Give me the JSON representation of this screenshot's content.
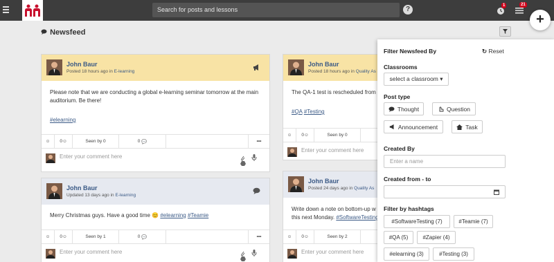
{
  "topbar": {
    "search_placeholder": "Search for posts and lessons",
    "help_label": "?",
    "notifications_count": "1",
    "tasks_count": "21",
    "add_label": "+"
  },
  "page": {
    "title": "Newsfeed"
  },
  "posts_left": [
    {
      "author": "John Baur",
      "meta_prefix": "Posted 18 hours ago in ",
      "classroom": "E-learning",
      "body": "Please note that we are conducting a global e-learning seminar tomorrow at the main auditorium. Be there!",
      "hashtags": "#elearning",
      "reactions": "0",
      "seen": "Seen by 0",
      "comments": "0",
      "more": "•••",
      "comment_placeholder": "Enter your comment here",
      "type": "announcement"
    },
    {
      "author": "John Baur",
      "meta_prefix": "Updated 13 days ago in ",
      "classroom": "E-learning",
      "body": "Merry Christmas guys. Have a good time 😊",
      "hashtag1": "#elearning",
      "hashtag2": "#Teamie",
      "reactions": "0",
      "seen": "Seen by 1",
      "comments": "0",
      "more": "•••",
      "comment_placeholder": "Enter your comment here",
      "type": "thought"
    }
  ],
  "posts_right": [
    {
      "author": "John Baur",
      "meta_prefix": "Posted 18 hours ago in ",
      "classroom": "Quality As",
      "body": "The QA-1 test is rescheduled from",
      "hashtag1": "#QA",
      "hashtag2": "#Testing",
      "reactions": "0",
      "seen": "Seen by 0",
      "comment_placeholder": "Enter your comment here"
    },
    {
      "author": "John Baur",
      "meta_prefix": "Posted 24 days ago in ",
      "classroom": "Quality As",
      "body_line1": "Write down a note on bottom-up w",
      "body_line2": "this next Monday. ",
      "hashtag1": "#SoftwareTesting",
      "hashtag2": "#",
      "reactions": "0",
      "seen": "Seen by 2",
      "comment_placeholder": "Enter your comment here"
    }
  ],
  "filter": {
    "title": "Filter Newsfeed By",
    "reset": "Reset",
    "classrooms_label": "Classrooms",
    "classroom_select": "select a classroom ▾",
    "post_type_label": "Post type",
    "types": [
      "Thought",
      "Question",
      "Announcement",
      "Task"
    ],
    "created_by_label": "Created By",
    "created_by_placeholder": "Enter a name",
    "created_range_label": "Created from - to",
    "hashtags_label": "Filter by hashtags",
    "hashtags": [
      "#SoftwareTesting (7)",
      "#Teamie (7)",
      "#QA (5)",
      "#Zapier (4)",
      "#elearning (3)",
      "#Testing (3)"
    ]
  },
  "colors": {
    "topbar": "#3d3d3d",
    "announcement_header": "#f8e3a5",
    "thought_header": "#e6e9f0",
    "link": "#3b5a86",
    "badge": "#d0021b"
  }
}
